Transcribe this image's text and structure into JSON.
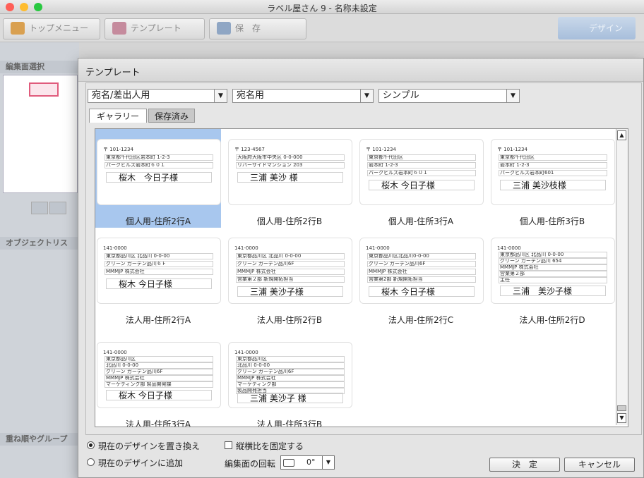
{
  "window": {
    "title": "ラベル屋さん 9 - 名称未設定"
  },
  "toolbar": {
    "top_menu": "トップメニュー",
    "template": "テンプレート",
    "save": "保　存",
    "design": "デザイン"
  },
  "background": {
    "edit_select": "編集面選択",
    "object_list": "オブジェクトリス",
    "layer_group": "重ね順やグループ"
  },
  "dialog": {
    "title": "テンプレート",
    "dropdowns": [
      {
        "value": "宛名/差出人用"
      },
      {
        "value": "宛名用"
      },
      {
        "value": "シンプル"
      }
    ],
    "tabs": {
      "gallery": "ギャラリー",
      "saved": "保存済み"
    },
    "templates": [
      {
        "caption": "個人用-住所2行A",
        "selected": true,
        "lines": [
          "〒 101-1234",
          "東京都千代田区岩本町 1-2-3",
          "パークヒルズ岩本町６０１",
          "桜木　今日子様"
        ]
      },
      {
        "caption": "個人用-住所2行B",
        "lines": [
          "〒 123-4567",
          "大阪府大阪市中央区 0-0-000",
          "リバーサイドマンション 203",
          "三浦 美沙 様"
        ]
      },
      {
        "caption": "個人用-住所3行A",
        "lines": [
          "〒 101-1234",
          "東京都千代田区",
          "岩本町 1-2-3",
          "パークヒルズ岩本町６０１",
          "桜木 今日子様"
        ]
      },
      {
        "caption": "個人用-住所3行B",
        "lines": [
          "〒 101-1234",
          "東京都千代田区",
          "岩本町 1-2-3",
          "パークヒルズ岩本町601",
          "三浦 美沙枝様"
        ]
      },
      {
        "caption": "法人用-住所2行A",
        "lines": [
          "141-0000",
          "東京都品川区 北品川 0-0-00",
          "グリーン ガーデン品川６Ｆ",
          "MMMJP 株式会社",
          "桜木 今日子様"
        ]
      },
      {
        "caption": "法人用-住所2行B",
        "lines": [
          "141-0000",
          "東京都品川区 北品川 0-0-00",
          "グリーン ガーデン品川6F",
          "MMMJP 株式会社",
          "営業第２部 新規開拓担当",
          "三浦 美沙子様"
        ]
      },
      {
        "caption": "法人用-住所2行C",
        "lines": [
          "141-0000",
          "東京都品川区北品川0-0-00",
          "グリーン ガーデン品川6F",
          "MMMJP 株式会社",
          "営業第2部 新規開拓担当",
          "桜木 今日子様"
        ]
      },
      {
        "caption": "法人用-住所2行D",
        "lines": [
          "141-0000",
          "東京都品川区 北品川 0-0-00",
          "グリーン ガーデン品川 654",
          "MMMJP 株式会社",
          "営業第２部",
          "主任",
          "三浦　美沙子様"
        ]
      },
      {
        "caption": "法人用-住所3行A",
        "lines": [
          "141-0000",
          "東京都品川区",
          "北品川 0-0-00",
          "グリーン ガーデン品川6F",
          "MMMJP 株式会社",
          "マーケティング部 製品開発課",
          "桜木 今日子様"
        ]
      },
      {
        "caption": "法人用-住所3行B",
        "lines": [
          "141-0000",
          "東京都品川区",
          "北品川 0-0-00",
          "グリーン ガーデン品川6F",
          "MMMJP 株式会社",
          "マーケティング部",
          "製品開発担当",
          "三浦 美沙子 様"
        ]
      }
    ],
    "options": {
      "replace_design": "現在のデザインを置き換え",
      "add_design": "現在のデザインに追加",
      "fix_aspect": "縦横比を固定する",
      "rotation_label": "編集面の回転",
      "rotation_value": "0°"
    },
    "buttons": {
      "ok": "決　定",
      "cancel": "キャンセル"
    }
  },
  "colors": {
    "selection": "#a8c7ee",
    "close": "#ff5f57",
    "minimize": "#febc2e",
    "zoom": "#28c840"
  }
}
